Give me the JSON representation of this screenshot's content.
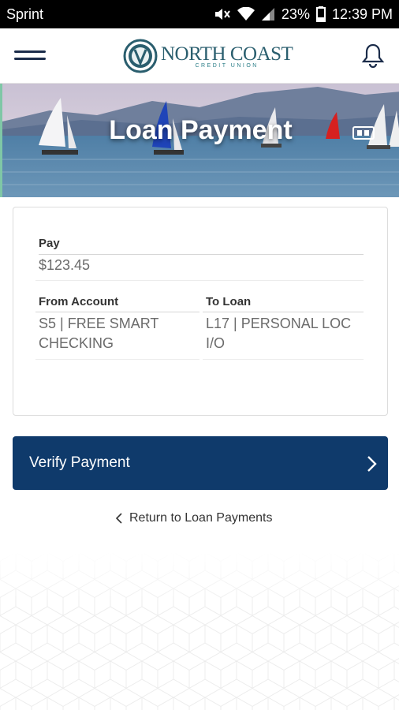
{
  "status_bar": {
    "carrier": "Sprint",
    "battery": "23%",
    "time": "12:39 PM"
  },
  "header": {
    "logo_name": "NORTH COAST",
    "logo_sub": "CREDIT UNION",
    "icons": [
      "menu-icon",
      "notification-bell-icon"
    ]
  },
  "banner": {
    "title": "Loan Payment",
    "icon": "camera-icon"
  },
  "form": {
    "pay": {
      "label": "Pay",
      "value": "$123.45"
    },
    "from_account": {
      "label": "From Account",
      "line1": "S5 | FREE SMART",
      "line2": "CHECKING"
    },
    "to_loan": {
      "label": "To Loan",
      "line1": "L17 | PERSONAL LOC",
      "line2": "I/O"
    }
  },
  "actions": {
    "verify_label": "Verify Payment",
    "return_label": "Return to Loan Payments"
  },
  "colors": {
    "primary": "#0f3a6b",
    "brand_teal": "#2a5e6e",
    "status_bar": "#000000"
  }
}
